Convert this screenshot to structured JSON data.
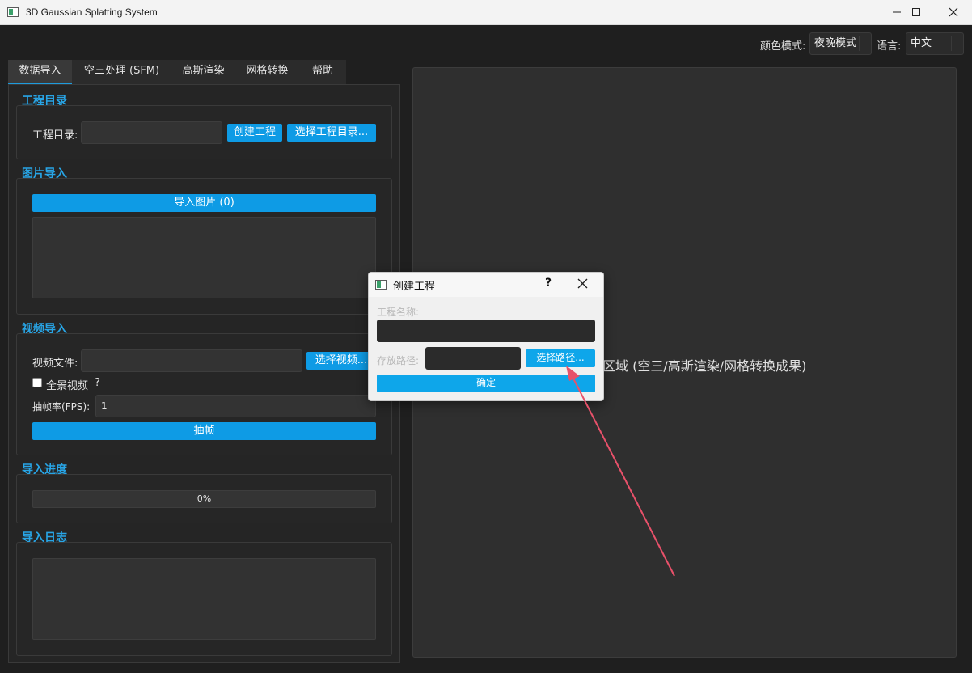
{
  "window": {
    "title": "3D Gaussian Splatting System",
    "minimize_glyph": "—",
    "maximize_glyph": "☐",
    "close_glyph": "✕"
  },
  "topbar": {
    "color_mode_label": "颜色模式:",
    "color_mode_value": "夜晚模式",
    "language_label": "语言:",
    "language_value": "中文"
  },
  "tabs": [
    {
      "label": "数据导入",
      "active": true
    },
    {
      "label": "空三处理 (SFM)",
      "active": false
    },
    {
      "label": "高斯渲染",
      "active": false
    },
    {
      "label": "网格转换",
      "active": false
    },
    {
      "label": "帮助",
      "active": false
    }
  ],
  "project": {
    "section_title": "工程目录",
    "dir_label": "工程目录:",
    "dir_value": "",
    "create_button": "创建工程",
    "select_button": "选择工程目录..."
  },
  "images": {
    "section_title": "图片导入",
    "import_button": "导入图片 (0)"
  },
  "video": {
    "section_title": "视频导入",
    "file_label": "视频文件:",
    "file_value": "",
    "select_button": "选择视频...",
    "panorama_label": "全景视频",
    "panorama_checked": false,
    "help_mark": "?",
    "fps_label": "抽帧率(FPS):",
    "fps_value": "1",
    "extract_button": "抽帧"
  },
  "progress": {
    "section_title": "导入进度",
    "value_text": "0%",
    "value": 0
  },
  "log": {
    "section_title": "导入日志"
  },
  "view": {
    "placeholder_text": "区域 (空三/高斯渲染/网格转换成果)"
  },
  "dialog": {
    "title": "创建工程",
    "help_glyph": "?",
    "name_label": "工程名称:",
    "name_value": "",
    "path_label": "存放路径:",
    "path_value": "",
    "select_path_button": "选择路径...",
    "confirm_button": "确定"
  },
  "colors": {
    "accent": "#0e9be5",
    "section_title": "#28a5e6",
    "background": "#1f1f1f",
    "annotation_arrow": "#e8516a"
  }
}
